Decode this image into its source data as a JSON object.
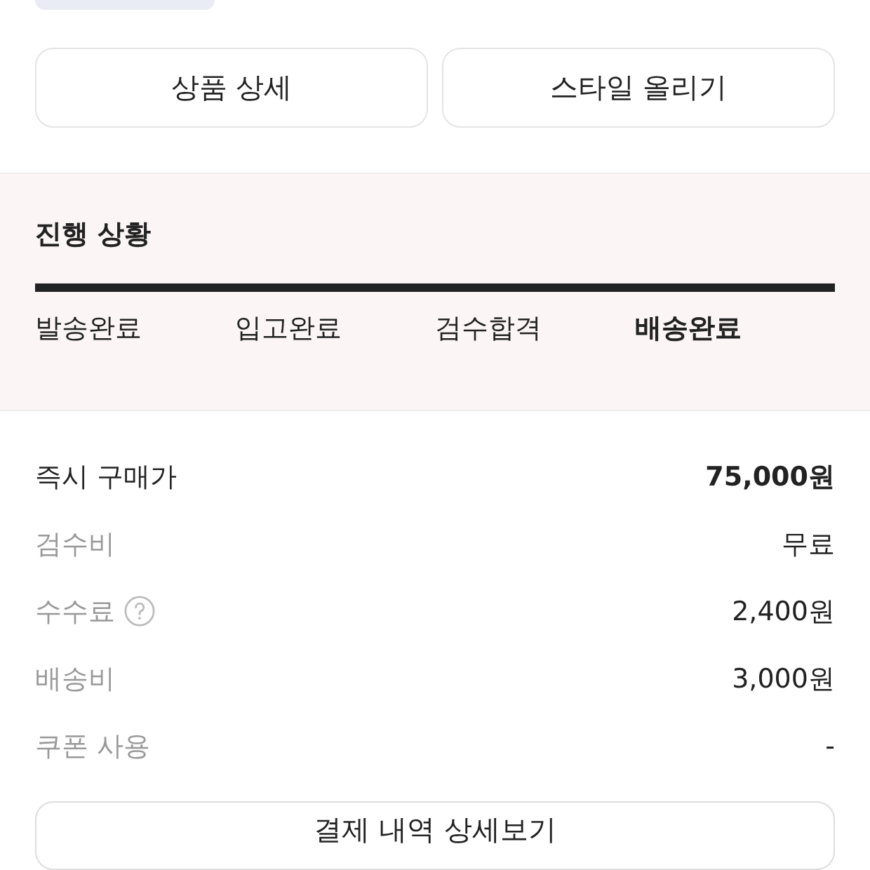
{
  "actions": [
    "상품 상세",
    "스타일 올리기"
  ],
  "progress": {
    "title": "진행 상황",
    "level": 1,
    "steps": [
      {
        "label": "발송완료",
        "selected": false
      },
      {
        "label": "입고완료",
        "selected": false
      },
      {
        "label": "검수합격",
        "selected": false
      },
      {
        "label": "배송완료",
        "selected": true
      }
    ]
  },
  "price_rows": [
    {
      "label": "즉시 구매가",
      "value": "75,000원",
      "emphasis": true,
      "help": false
    },
    {
      "label": "검수비",
      "value": "무료",
      "emphasis": false,
      "help": false
    },
    {
      "label": "수수료",
      "value": "2,400원",
      "emphasis": false,
      "help": true
    },
    {
      "label": "배송비",
      "value": "3,000원",
      "emphasis": false,
      "help": false
    },
    {
      "label": "쿠폰 사용",
      "value": "-",
      "emphasis": false,
      "help": false
    }
  ],
  "detail_button": "결제 내역 상세보기"
}
